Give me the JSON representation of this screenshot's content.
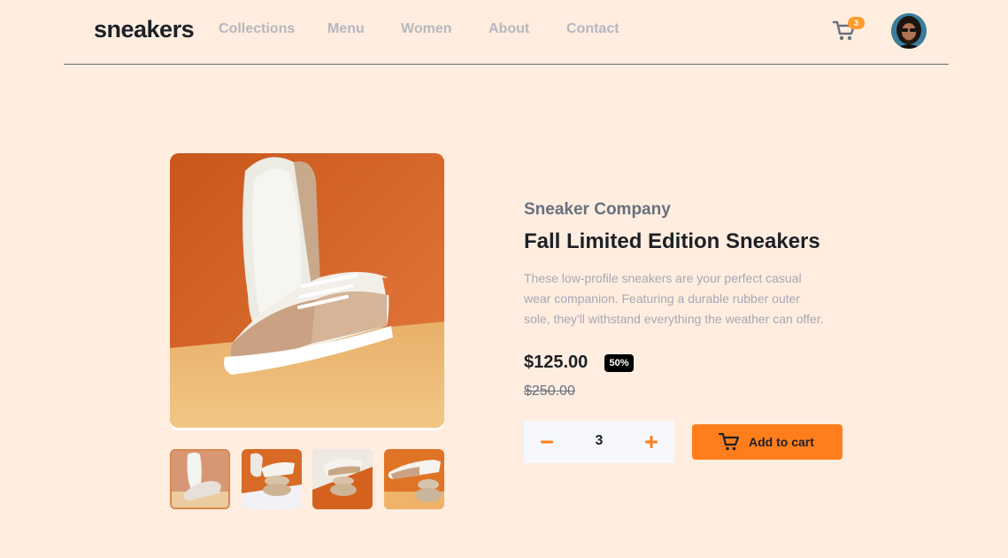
{
  "header": {
    "logo": "sneakers",
    "nav": [
      "Collections",
      "Menu",
      "Women",
      "About",
      "Contact"
    ],
    "cart_count": "3"
  },
  "gallery": {
    "main_alt": "Fall Limited Edition Sneakers product photo 1",
    "thumbnails": [
      "thumbnail 1",
      "thumbnail 2",
      "thumbnail 3",
      "thumbnail 4"
    ],
    "active_index": 0
  },
  "product": {
    "company": "Sneaker Company",
    "title": "Fall Limited Edition Sneakers",
    "description_lines": [
      "These low-profile sneakers are your perfect casual",
      "wear companion. Featuring a durable rubber outer",
      "sole, they'll withstand everything the weather can offer."
    ],
    "price": "$125.00",
    "discount": "50%",
    "original_price": "$250.00",
    "quantity": "3",
    "add_to_cart_label": "Add to cart"
  },
  "colors": {
    "background": "#ffede0",
    "accent": "#ff7e1b",
    "badge": "#ff9b2c",
    "heading": "#1d2026",
    "muted": "#68707d"
  },
  "icons": {
    "cart": "cart-icon",
    "minus": "minus-icon",
    "plus": "plus-icon"
  }
}
